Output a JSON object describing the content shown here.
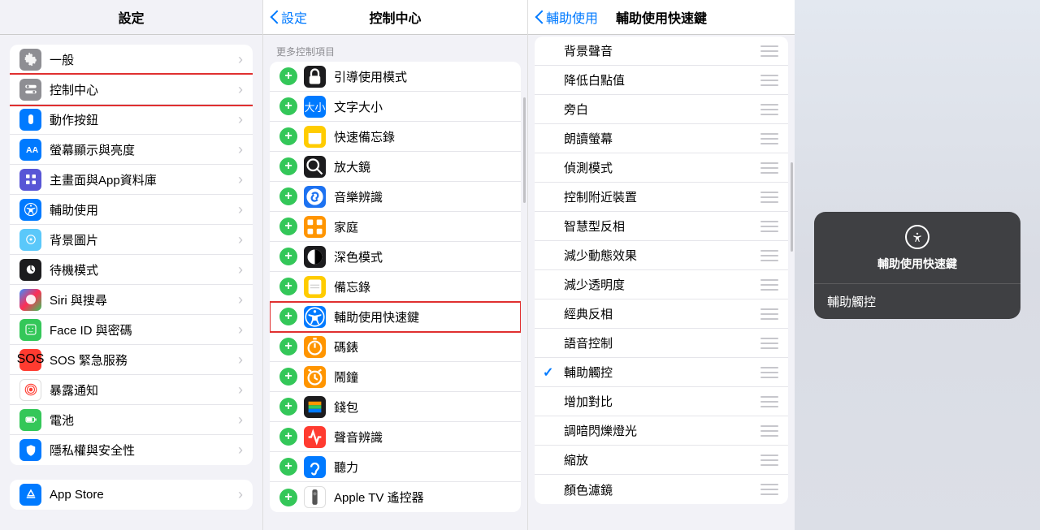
{
  "col1": {
    "title": "設定",
    "groups": [
      [
        {
          "label": "一般",
          "icon": "gear",
          "color": "ic-gray",
          "name": "general"
        },
        {
          "label": "控制中心",
          "icon": "switches",
          "color": "ic-gray",
          "name": "control-center",
          "highlight": true
        },
        {
          "label": "動作按鈕",
          "icon": "action",
          "color": "ic-blue",
          "name": "action-button"
        },
        {
          "label": "螢幕顯示與亮度",
          "icon": "brightness",
          "color": "ic-blue",
          "name": "display"
        },
        {
          "label": "主畫面與App資料庫",
          "icon": "home",
          "color": "ic-purple",
          "name": "home-screen"
        },
        {
          "label": "輔助使用",
          "icon": "accessibility",
          "color": "ic-blue",
          "name": "accessibility"
        },
        {
          "label": "背景圖片",
          "icon": "wallpaper",
          "color": "ic-cyan",
          "name": "wallpaper"
        },
        {
          "label": "待機模式",
          "icon": "standby",
          "color": "ic-black",
          "name": "standby"
        },
        {
          "label": "Siri 與搜尋",
          "icon": "siri",
          "color": "ic-siri",
          "name": "siri"
        },
        {
          "label": "Face ID 與密碼",
          "icon": "faceid",
          "color": "ic-green",
          "name": "faceid"
        },
        {
          "label": "SOS 緊急服務",
          "icon": "sos",
          "color": "ic-red",
          "name": "sos"
        },
        {
          "label": "暴露通知",
          "icon": "exposure",
          "color": "ic-white",
          "name": "exposure"
        },
        {
          "label": "電池",
          "icon": "battery",
          "color": "ic-green",
          "name": "battery"
        },
        {
          "label": "隱私權與安全性",
          "icon": "privacy",
          "color": "ic-blue",
          "name": "privacy"
        }
      ],
      [
        {
          "label": "App Store",
          "icon": "appstore",
          "color": "ic-blue",
          "name": "app-store"
        }
      ]
    ]
  },
  "col2": {
    "back": "設定",
    "title": "控制中心",
    "section_header": "更多控制項目",
    "items": [
      {
        "label": "引導使用模式",
        "icon": "lock",
        "color": "ic-black",
        "name": "guided-access"
      },
      {
        "label": "文字大小",
        "icon": "textsize",
        "color": "ic-blue",
        "name": "text-size"
      },
      {
        "label": "快速備忘錄",
        "icon": "quicknote",
        "color": "ic-yellow",
        "name": "quick-note"
      },
      {
        "label": "放大鏡",
        "icon": "magnifier",
        "color": "ic-black",
        "name": "magnifier"
      },
      {
        "label": "音樂辨識",
        "icon": "shazam",
        "color": "ic-darkblue",
        "name": "shazam"
      },
      {
        "label": "家庭",
        "icon": "home",
        "color": "ic-orange",
        "name": "home-app"
      },
      {
        "label": "深色模式",
        "icon": "darkmode",
        "color": "ic-black",
        "name": "dark-mode"
      },
      {
        "label": "備忘錄",
        "icon": "notes",
        "color": "ic-yellow",
        "name": "notes"
      },
      {
        "label": "輔助使用快速鍵",
        "icon": "accessibility",
        "color": "ic-blue",
        "name": "accessibility-shortcut",
        "highlight": true
      },
      {
        "label": "碼錶",
        "icon": "stopwatch",
        "color": "ic-orange",
        "name": "stopwatch"
      },
      {
        "label": "鬧鐘",
        "icon": "alarm",
        "color": "ic-orange",
        "name": "alarm"
      },
      {
        "label": "錢包",
        "icon": "wallet",
        "color": "ic-black",
        "name": "wallet"
      },
      {
        "label": "聲音辨識",
        "icon": "soundrecog",
        "color": "ic-red",
        "name": "sound-recognition"
      },
      {
        "label": "聽力",
        "icon": "hearing",
        "color": "ic-blue",
        "name": "hearing"
      },
      {
        "label": "Apple TV 遙控器",
        "icon": "remote",
        "color": "ic-white",
        "name": "appletv-remote"
      }
    ]
  },
  "col3": {
    "back": "輔助使用",
    "title": "輔助使用快速鍵",
    "items": [
      {
        "label": "背景聲音",
        "name": "background-sounds"
      },
      {
        "label": "降低白點值",
        "name": "reduce-white-point"
      },
      {
        "label": "旁白",
        "name": "voiceover"
      },
      {
        "label": "朗讀螢幕",
        "name": "speak-screen"
      },
      {
        "label": "偵測模式",
        "name": "detection-mode"
      },
      {
        "label": "控制附近裝置",
        "name": "control-nearby"
      },
      {
        "label": "智慧型反相",
        "name": "smart-invert"
      },
      {
        "label": "減少動態效果",
        "name": "reduce-motion"
      },
      {
        "label": "減少透明度",
        "name": "reduce-transparency"
      },
      {
        "label": "經典反相",
        "name": "classic-invert"
      },
      {
        "label": "語音控制",
        "name": "voice-control"
      },
      {
        "label": "輔助觸控",
        "name": "assistive-touch",
        "checked": true
      },
      {
        "label": "增加對比",
        "name": "increase-contrast"
      },
      {
        "label": "調暗閃爍燈光",
        "name": "dim-flashing"
      },
      {
        "label": "縮放",
        "name": "zoom"
      },
      {
        "label": "顏色濾鏡",
        "name": "color-filters"
      }
    ]
  },
  "popup": {
    "title": "輔助使用快速鍵",
    "item": "輔助觸控"
  }
}
